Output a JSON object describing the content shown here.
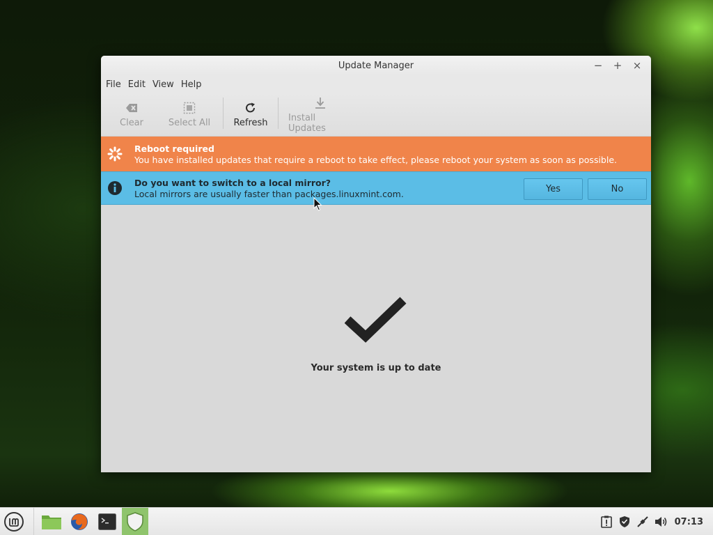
{
  "window": {
    "title": "Update Manager",
    "controls": {
      "minimize": "−",
      "maximize": "+",
      "close": "×"
    }
  },
  "menu": [
    "File",
    "Edit",
    "View",
    "Help"
  ],
  "toolbar": {
    "clear": "Clear",
    "select_all": "Select All",
    "refresh": "Refresh",
    "install_updates": "Install Updates"
  },
  "reboot_bar": {
    "title": "Reboot required",
    "message": "You have installed updates that require a reboot to take effect, please reboot your system as soon as possible.",
    "color": "#f0844a"
  },
  "mirror_bar": {
    "title": "Do you want to switch to a local mirror?",
    "message": "Local mirrors are usually faster than packages.linuxmint.com.",
    "yes": "Yes",
    "no": "No",
    "color": "#5bbde6"
  },
  "status": {
    "icon": "checkmark-icon",
    "text": "Your system is up to date"
  },
  "panel": {
    "launcher_icon": "mint-menu-icon",
    "apps": [
      "file-manager-icon",
      "firefox-icon",
      "terminal-icon",
      "update-manager-shield-icon"
    ],
    "tray": [
      "update-notifier-icon",
      "shield-icon",
      "network-icon",
      "volume-icon"
    ],
    "clock": "07:13"
  }
}
